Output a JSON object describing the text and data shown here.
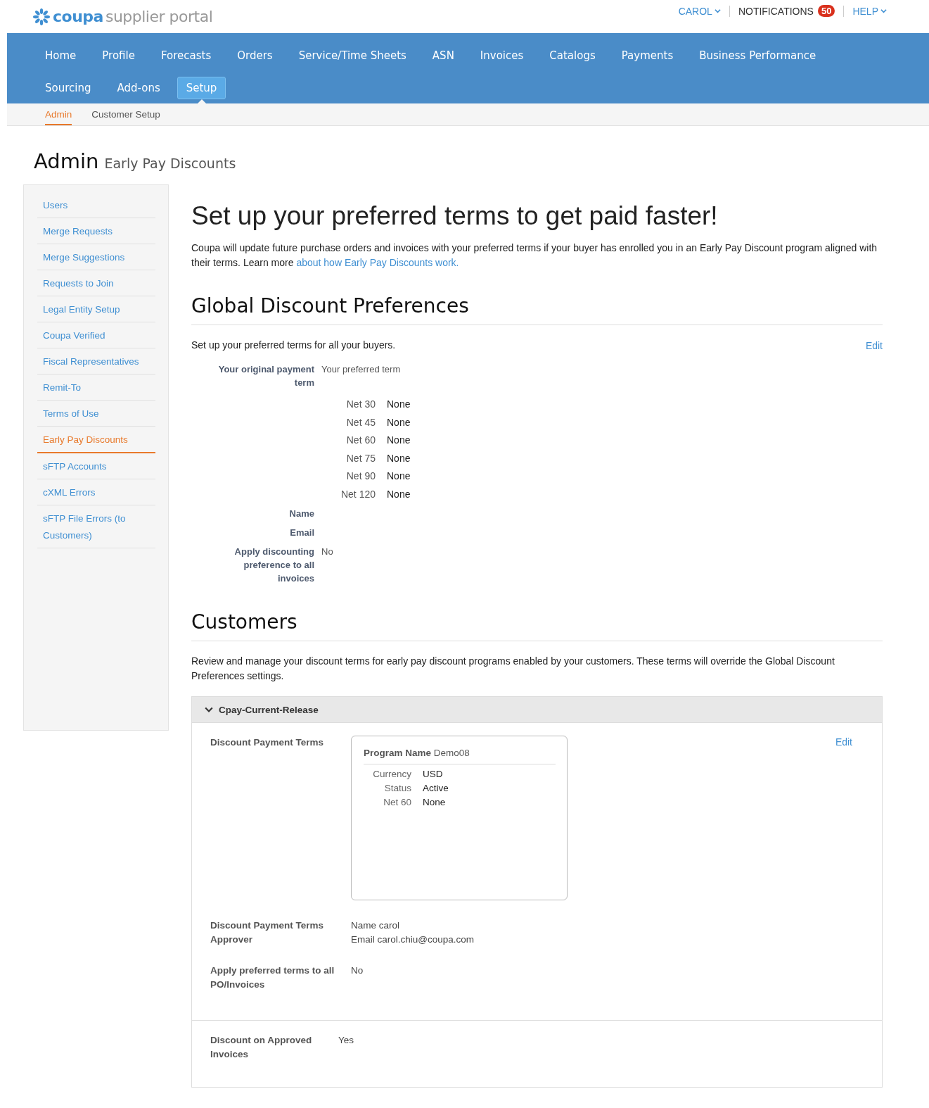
{
  "header": {
    "logo": {
      "brand": "coupa",
      "product": "supplier portal"
    },
    "user_menu": "CAROL",
    "notifications": {
      "label": "NOTIFICATIONS",
      "count": "50"
    },
    "help": "HELP"
  },
  "nav": {
    "rows": [
      [
        {
          "label": "Home",
          "selected": false
        },
        {
          "label": "Profile",
          "selected": false
        },
        {
          "label": "Forecasts",
          "selected": false
        },
        {
          "label": "Orders",
          "selected": false
        },
        {
          "label": "Service/Time Sheets",
          "selected": false
        },
        {
          "label": "ASN",
          "selected": false
        },
        {
          "label": "Invoices",
          "selected": false
        },
        {
          "label": "Catalogs",
          "selected": false
        },
        {
          "label": "Payments",
          "selected": false
        },
        {
          "label": "Business Performance",
          "selected": false
        }
      ],
      [
        {
          "label": "Sourcing",
          "selected": false
        },
        {
          "label": "Add-ons",
          "selected": false
        },
        {
          "label": "Setup",
          "selected": true
        }
      ]
    ]
  },
  "subnav": [
    {
      "label": "Admin",
      "selected": true
    },
    {
      "label": "Customer Setup",
      "selected": false
    }
  ],
  "page_title": {
    "title": "Admin",
    "subtitle": "Early Pay Discounts"
  },
  "sidebar": {
    "items": [
      {
        "label": "Users",
        "selected": false
      },
      {
        "label": "Merge Requests",
        "selected": false
      },
      {
        "label": "Merge Suggestions",
        "selected": false
      },
      {
        "label": "Requests to Join",
        "selected": false
      },
      {
        "label": "Legal Entity Setup",
        "selected": false
      },
      {
        "label": "Coupa Verified",
        "selected": false
      },
      {
        "label": "Fiscal Representatives",
        "selected": false
      },
      {
        "label": "Remit-To",
        "selected": false
      },
      {
        "label": "Terms of Use",
        "selected": false
      },
      {
        "label": "Early Pay Discounts",
        "selected": true
      },
      {
        "label": "sFTP Accounts",
        "selected": false
      },
      {
        "label": "cXML Errors",
        "selected": false
      },
      {
        "label": "sFTP File Errors (to Customers)",
        "selected": false
      }
    ]
  },
  "main": {
    "heading": "Set up your preferred terms to get paid faster!",
    "intro": "Coupa will update future purchase orders and invoices with your preferred terms if your buyer has enrolled you in an Early Pay Discount program aligned with their terms. Learn more",
    "intro_link": "about how Early Pay Discounts work.",
    "global": {
      "title": "Global Discount Preferences",
      "description": "Set up your preferred terms for all your buyers.",
      "edit": "Edit",
      "term_header": {
        "label": "Your original payment term",
        "value": "Your preferred term"
      },
      "terms": [
        {
          "term": "Net 30",
          "value": "None"
        },
        {
          "term": "Net 45",
          "value": "None"
        },
        {
          "term": "Net 60",
          "value": "None"
        },
        {
          "term": "Net 75",
          "value": "None"
        },
        {
          "term": "Net 90",
          "value": "None"
        },
        {
          "term": "Net 120",
          "value": "None"
        }
      ],
      "fields": [
        {
          "label": "Name"
        },
        {
          "label": "Email"
        },
        {
          "label": "Apply discounting preference to all invoices",
          "value": "No"
        }
      ]
    },
    "customers": {
      "title": "Customers",
      "description": "Review and manage your discount terms for early pay discount programs enabled by your customers. These terms will override the Global Discount Preferences settings.",
      "panel": {
        "name": "Cpay-Current-Release",
        "expanded": true,
        "edit": "Edit",
        "terms_label": "Discount Payment Terms",
        "program": {
          "label": "Program Name",
          "name": "Demo08",
          "rows": [
            {
              "label": "Currency",
              "value": "USD"
            },
            {
              "label": "Status",
              "value": "Active"
            },
            {
              "label": "Net 60",
              "value": "None"
            }
          ]
        },
        "approver": {
          "label": "Discount Payment Terms Approver",
          "name_label": "Name",
          "name": "carol",
          "email_label": "Email",
          "email": "carol.chiu@coupa.com"
        },
        "apply": {
          "label": "Apply preferred terms to all PO/Invoices",
          "value": "No"
        },
        "approved": {
          "label": "Discount on Approved Invoices",
          "value": "Yes"
        }
      }
    }
  }
}
